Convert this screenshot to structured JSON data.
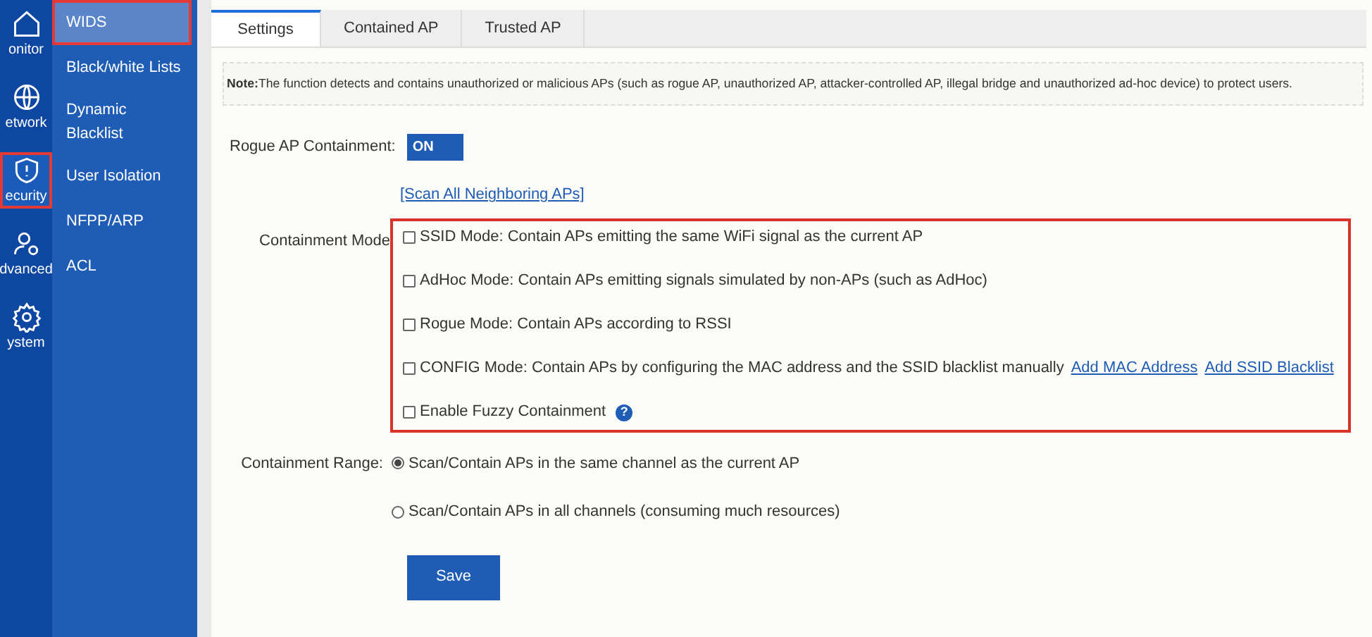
{
  "rail": [
    {
      "kind": "home",
      "label": "onitor",
      "selected": false,
      "highlighted": false
    },
    {
      "kind": "globe",
      "label": "etwork",
      "selected": false,
      "highlighted": false
    },
    {
      "kind": "shield",
      "label": "ecurity",
      "selected": true,
      "highlighted": true
    },
    {
      "kind": "users",
      "label": "dvanced",
      "selected": false,
      "highlighted": false
    },
    {
      "kind": "gear",
      "label": "ystem",
      "selected": false,
      "highlighted": false
    }
  ],
  "submenu": [
    {
      "label": "WIDS",
      "selected": true,
      "highlighted": true
    },
    {
      "label": "Black/white Lists",
      "selected": false,
      "highlighted": false
    },
    {
      "label": "Dynamic Blacklist",
      "selected": false,
      "highlighted": false
    },
    {
      "label": "User Isolation",
      "selected": false,
      "highlighted": false
    },
    {
      "label": "NFPP/ARP",
      "selected": false,
      "highlighted": false
    },
    {
      "label": "ACL",
      "selected": false,
      "highlighted": false
    }
  ],
  "tabs": [
    {
      "label": "Settings",
      "selected": true
    },
    {
      "label": "Contained AP",
      "selected": false
    },
    {
      "label": "Trusted AP",
      "selected": false
    }
  ],
  "note": "**Note:**The function detects and contains unauthorized or malicious APs (such as rogue AP, unauthorized AP, attacker-controlled AP, illegal bridge and unauthorized ad-hoc device) to protect users.",
  "rogue": {
    "label": "Rogue AP Containment:",
    "toggle": "ON",
    "on": true
  },
  "scan_link": "[Scan All Neighboring APs]",
  "modes": {
    "label": "Containment Mode",
    "highlighted": true,
    "options": [
      {
        "text": "SSID Mode: Contain APs emitting the same WiFi signal as the current AP",
        "checked": false
      },
      {
        "text": "AdHoc Mode: Contain APs emitting signals simulated by non-APs (such as AdHoc)",
        "checked": false
      },
      {
        "text": "Rogue Mode: Contain APs according to RSSI",
        "checked": false
      },
      {
        "text": "CONFIG Mode: Contain APs by configuring the MAC address and the SSID blacklist manually",
        "checked": false,
        "links": [
          "Add MAC Address",
          "Add SSID Blacklist"
        ]
      },
      {
        "text": "Enable Fuzzy Containment",
        "checked": false,
        "help": "?"
      }
    ]
  },
  "range": {
    "label": "Containment Range:",
    "options": [
      {
        "text": "Scan/Contain APs in the same channel as the current AP",
        "selected": true
      },
      {
        "text": "Scan/Contain APs in all channels (consuming much resources)",
        "selected": false
      }
    ]
  },
  "save": "Save"
}
